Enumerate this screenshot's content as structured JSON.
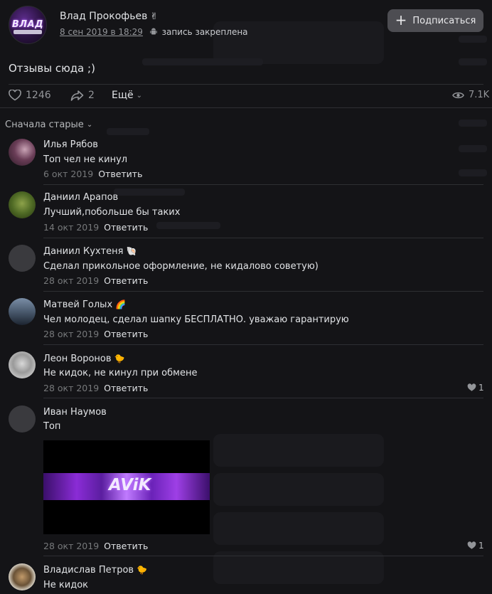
{
  "post": {
    "author": "Влад Прокофьев",
    "author_emoji": "✌",
    "avatar_text": "ВЛАД",
    "date": "8 сен 2019 в 18:29",
    "pinned": "запись закреплена",
    "subscribe": "Подписаться",
    "text": "Отзывы сюда ;)",
    "likes": "1246",
    "shares": "2",
    "more": "Ещё",
    "views": "7.1K"
  },
  "sort": {
    "label": "Сначала старые"
  },
  "comments": [
    {
      "name": "Илья Рябов",
      "emoji": "",
      "text": "Топ чел не кинул",
      "date": "6 окт 2019",
      "reply": "Ответить",
      "likes": ""
    },
    {
      "name": "Даниил Арапов",
      "emoji": "",
      "text": "Лучший,побольше бы таких",
      "date": "14 окт 2019",
      "reply": "Ответить",
      "likes": ""
    },
    {
      "name": "Даниил Кухтеня",
      "emoji": "🐚",
      "text": "Сделал прикольное оформление, не кидалово советую)",
      "date": "28 окт 2019",
      "reply": "Ответить",
      "likes": ""
    },
    {
      "name": "Матвей Голых",
      "emoji": "🌈",
      "text": "Чел молодец, сделал шапку БЕСПЛАТНО. уважаю гарантирую",
      "date": "28 окт 2019",
      "reply": "Ответить",
      "likes": ""
    },
    {
      "name": "Леон Воронов",
      "emoji": "🐤",
      "text": "Не кидок, не кинул при обмене",
      "date": "28 окт 2019",
      "reply": "Ответить",
      "likes": "1"
    },
    {
      "name": "Иван Наумов",
      "emoji": "",
      "text": "Топ",
      "date": "28 окт 2019",
      "reply": "Ответить",
      "likes": "1",
      "banner_text": "AViK"
    },
    {
      "name": "Владислав Петров",
      "emoji": "🐤",
      "text": "Не кидок",
      "date": "",
      "reply": "",
      "likes": ""
    }
  ],
  "colors": {
    "background": "#141417",
    "text_primary": "#e1e3e6",
    "text_secondary": "#939599",
    "separator": "#2e2f33",
    "button_bg": "#4d4d52"
  }
}
